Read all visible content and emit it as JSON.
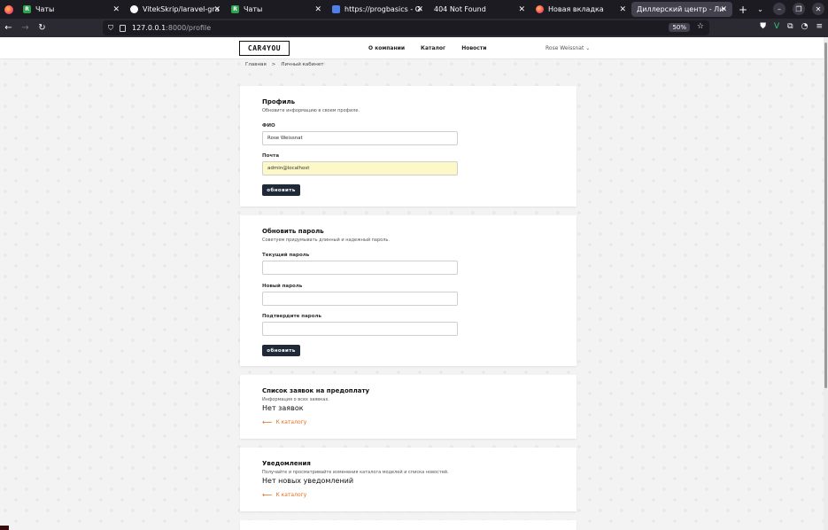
{
  "browser": {
    "tabs": [
      {
        "label": "Чаты",
        "favicon": "green-square-icon",
        "width": 121
      },
      {
        "label": "VitekSkrip/laravel-grade",
        "favicon": "github-icon",
        "width": 114
      },
      {
        "label": "Чаты",
        "favicon": "green-square-icon",
        "width": 114
      },
      {
        "label": "https://progbasics - Goo",
        "favicon": "docs-icon",
        "width": 115
      },
      {
        "label": "404 Not Found",
        "favicon": "",
        "width": 115
      },
      {
        "label": "Новая вкладка",
        "favicon": "firefox-icon",
        "width": 114
      },
      {
        "label": "Диллерский центр - Личн",
        "favicon": "",
        "width": 114,
        "active": true
      }
    ],
    "url_host": "127.0.0.1",
    "url_path": ":8000/profile",
    "zoom": "50%"
  },
  "header": {
    "logo": "CAR4YOU",
    "menu": [
      "О компании",
      "Каталог",
      "Новости"
    ],
    "user": "Rose Weissnat ⌄"
  },
  "breadcrumb": {
    "home": "Главная",
    "separator": ">",
    "current": "Личный кабинет"
  },
  "profile": {
    "title": "Профиль",
    "subtitle": "Обновите информацию в своем профиле.",
    "name_label": "ФИО",
    "name_value": "Rose Weissnat",
    "email_label": "Почта",
    "email_value": "admin@localhost",
    "button": "обновить"
  },
  "password": {
    "title": "Обновить пароль",
    "subtitle": "Советуем придумывать длинный и надежный пароль.",
    "current_label": "Текущий пароль",
    "new_label": "Новый пароль",
    "confirm_label": "Подтвердите пароль",
    "button": "обновить"
  },
  "orders": {
    "title": "Список заявок на предоплату",
    "subtitle": "Информация о всех заявках.",
    "empty": "Нет заявок",
    "back": "К каталогу"
  },
  "notifications": {
    "title": "Уведомления",
    "subtitle": "Получайте и просматривайте изменения каталога моделей и списка новостей.",
    "empty": "Нет новых уведомлений",
    "back": "К каталогу"
  }
}
